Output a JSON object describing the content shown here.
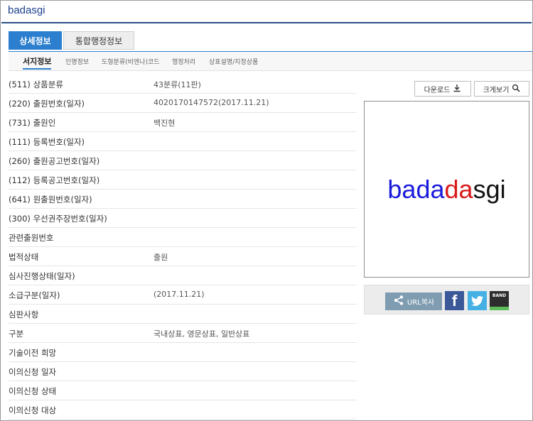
{
  "header": {
    "title": "badasgi"
  },
  "tabs": [
    {
      "label": "상세정보"
    },
    {
      "label": "통합행정정보"
    }
  ],
  "subnav": [
    {
      "label": "서지정보"
    },
    {
      "label": "인명정보"
    },
    {
      "label": "도형분류(비엔나)코드"
    },
    {
      "label": "행정처리"
    },
    {
      "label": "상표설명/지정상품"
    }
  ],
  "details": [
    {
      "label": "(511) 상품분류",
      "value": "43분류(11판)"
    },
    {
      "label": "(220) 출원번호(일자)",
      "value": "4020170147572(2017.11.21)"
    },
    {
      "label": "(731) 출원인",
      "value": "백진현"
    },
    {
      "label": "(111) 등록번호(일자)",
      "value": ""
    },
    {
      "label": "(260) 출원공고번호(일자)",
      "value": ""
    },
    {
      "label": "(112) 등록공고번호(일자)",
      "value": ""
    },
    {
      "label": "(641) 원출원번호(일자)",
      "value": ""
    },
    {
      "label": "(300) 우선권주장번호(일자)",
      "value": ""
    },
    {
      "label": "관련출원번호",
      "value": ""
    },
    {
      "label": "법적상태",
      "value": "출원"
    },
    {
      "label": "심사진행상태(일자)",
      "value": ""
    },
    {
      "label": "소급구분(일자)",
      "value": "(2017.11.21)"
    },
    {
      "label": "심판사항",
      "value": ""
    },
    {
      "label": "구분",
      "value": "국내상표, 영문상표, 일반상표"
    },
    {
      "label": "기술이전 희망",
      "value": ""
    },
    {
      "label": "이의신청 일자",
      "value": ""
    },
    {
      "label": "이의신청 상태",
      "value": ""
    },
    {
      "label": "이의신청 대상",
      "value": ""
    }
  ],
  "buttons": {
    "download": "다운로드",
    "zoom": "크게보기"
  },
  "trademark": {
    "parts": [
      {
        "text": "bad",
        "color": "#1a1adb"
      },
      {
        "text": "a",
        "color": "#1a1adb"
      },
      {
        "text": "da",
        "color": "#d91a1a"
      },
      {
        "text": "sgi",
        "color": "#111111"
      }
    ]
  },
  "share": {
    "url_label": "URL복사",
    "band_label": "BAND"
  },
  "colors": {
    "accent": "#2b7fce",
    "title_line": "#2b4f86"
  },
  "icons": {
    "download": "download-icon",
    "zoom": "magnifier-icon",
    "share": "share-icon"
  }
}
